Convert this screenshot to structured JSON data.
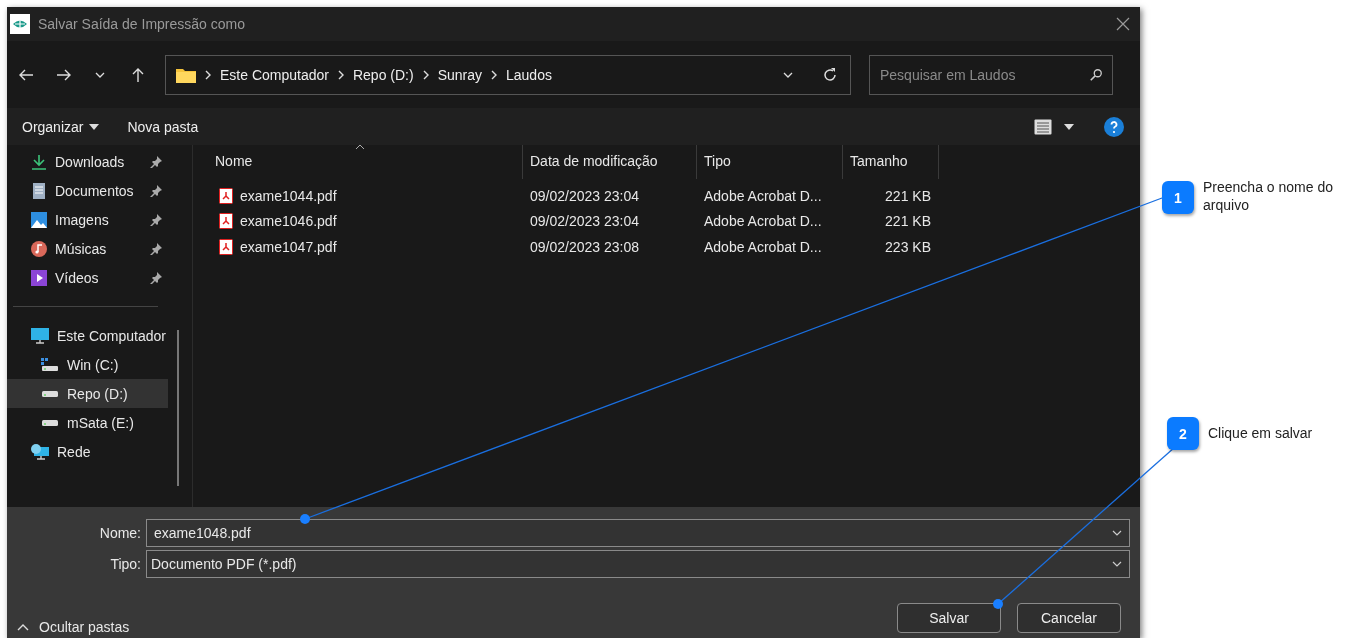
{
  "window": {
    "title": "Salvar Saída de Impressão como"
  },
  "breadcrumb": [
    "Este Computador",
    "Repo (D:)",
    "Sunray",
    "Laudos"
  ],
  "search": {
    "placeholder": "Pesquisar em Laudos"
  },
  "toolbar": {
    "organize": "Organizar",
    "new_folder": "Nova pasta"
  },
  "sidebar": {
    "items": [
      {
        "label": "Downloads",
        "kind": "downloads",
        "pinned": true,
        "selected": false
      },
      {
        "label": "Documentos",
        "kind": "documents",
        "pinned": true,
        "selected": false
      },
      {
        "label": "Imagens",
        "kind": "pictures",
        "pinned": true,
        "selected": false
      },
      {
        "label": "Músicas",
        "kind": "music",
        "pinned": true,
        "selected": false
      },
      {
        "label": "Vídeos",
        "kind": "videos",
        "pinned": true,
        "selected": false
      },
      {
        "label": "Este Computador",
        "kind": "computer",
        "pinned": false,
        "selected": false,
        "children": [
          {
            "label": "Win (C:)",
            "kind": "system-drive",
            "pinned": false,
            "selected": false
          },
          {
            "label": "Repo (D:)",
            "kind": "drive",
            "pinned": false,
            "selected": true
          },
          {
            "label": "mSata (E:)",
            "kind": "drive",
            "pinned": false,
            "selected": false
          }
        ]
      },
      {
        "label": "Rede",
        "kind": "network",
        "pinned": false,
        "selected": false
      }
    ]
  },
  "table": {
    "columns": [
      {
        "label": "Nome",
        "sorted": true
      },
      {
        "label": "Data de modificação",
        "sorted": false
      },
      {
        "label": "Tipo",
        "sorted": false
      },
      {
        "label": "Tamanho",
        "sorted": false
      }
    ],
    "rows": [
      {
        "name": "exame1044.pdf",
        "date": "09/02/2023 23:04",
        "type": "Adobe Acrobat D...",
        "size": "221 KB"
      },
      {
        "name": "exame1046.pdf",
        "date": "09/02/2023 23:04",
        "type": "Adobe Acrobat D...",
        "size": "221 KB"
      },
      {
        "name": "exame1047.pdf",
        "date": "09/02/2023 23:08",
        "type": "Adobe Acrobat D...",
        "size": "223 KB"
      }
    ]
  },
  "form": {
    "name_label": "Nome:",
    "name_value": "exame1048.pdf",
    "type_label": "Tipo:",
    "type_value": "Documento PDF (*.pdf)"
  },
  "hide_folders": "Ocultar pastas",
  "buttons": [
    "Salvar",
    "Cancelar"
  ],
  "callouts": [
    {
      "number": "1",
      "text": "Preencha o nome do arquivo"
    },
    {
      "number": "2",
      "text": "Clique em salvar"
    }
  ]
}
